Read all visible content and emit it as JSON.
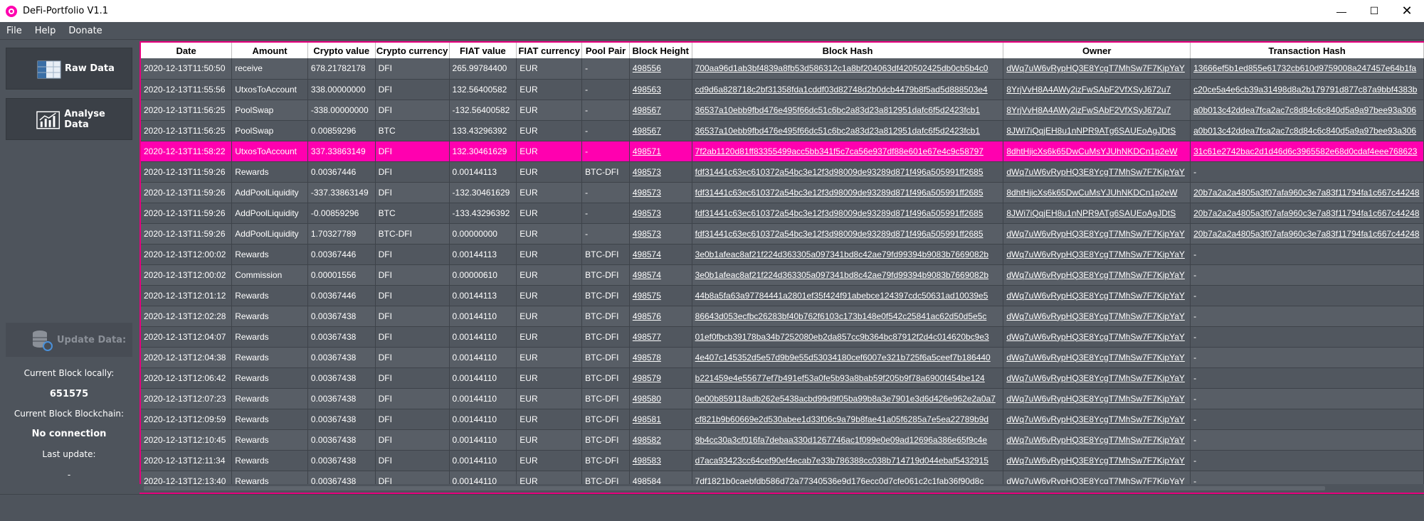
{
  "window": {
    "title": "DeFi-Portfolio V1.1"
  },
  "menu": [
    "File",
    "Help",
    "Donate"
  ],
  "sidebar": {
    "raw_data_label": "Raw Data",
    "analyse_data_label": "Analyse Data",
    "update_label": "Update Data:",
    "current_block_locally_label": "Current Block locally:",
    "current_block_locally_value": "651575",
    "current_block_blockchain_label": "Current Block Blockchain:",
    "current_block_blockchain_value": "No connection",
    "last_update_label": "Last update:",
    "last_update_value": "-"
  },
  "colors": {
    "accent": "#ff00af",
    "background": "#4e545c"
  },
  "table": {
    "columns": [
      "Date",
      "Amount",
      "Crypto value",
      "Crypto currency",
      "FIAT value",
      "FIAT currency",
      "Pool Pair",
      "Block Height",
      "Block Hash",
      "Owner",
      "Transaction Hash"
    ],
    "selected_row": 4,
    "rows": [
      [
        "2020-12-13T11:50:50",
        "receive",
        "678.21782178",
        "DFI",
        "265.99784400",
        "EUR",
        "-",
        "498556",
        "700aa96d1ab3bf4839a8fb53d586312c1a8bf204063df420502425db0cb5b4c0",
        "dWq7uW6vRypHQ3E8YcgT7MhSw7F7KipYaY",
        "13666ef5b1ed855e61732cb610d9759008a247457e64b1fa"
      ],
      [
        "2020-12-13T11:55:56",
        "UtxosToAccount",
        "338.00000000",
        "DFI",
        "132.56400582",
        "EUR",
        "-",
        "498563",
        "cd9d6a828718c2bf31358fda1cddf03d82748d2b0dcb4479b8f5ad5d888503e4",
        "8YrjVvH8A4AWy2izFwSAbF2VfXSyJ672u7",
        "c20ce5a4e6cb39a31498d8a2b179791d877c87a9bbf4383b"
      ],
      [
        "2020-12-13T11:56:25",
        "PoolSwap",
        "-338.00000000",
        "DFI",
        "-132.56400582",
        "EUR",
        "-",
        "498567",
        "36537a10ebb9fbd476e495f66dc51c6bc2a83d23a812951dafc6f5d2423fcb1",
        "8YrjVvH8A4AWy2izFwSAbF2VfXSyJ672u7",
        "a0b013c42ddea7fca2ac7c8d84c6c840d5a9a97bee93a306"
      ],
      [
        "2020-12-13T11:56:25",
        "PoolSwap",
        "0.00859296",
        "BTC",
        "133.43296392",
        "EUR",
        "-",
        "498567",
        "36537a10ebb9fbd476e495f66dc51c6bc2a83d23a812951dafc6f5d2423fcb1",
        "8JWi7iQqjEH8u1nNPR9ATg6SAUEoAgJDtS",
        "a0b013c42ddea7fca2ac7c8d84c6c840d5a9a97bee93a306"
      ],
      [
        "2020-12-13T11:58:22",
        "UtxosToAccount",
        "337.33863149",
        "DFI",
        "132.30461629",
        "EUR",
        "-",
        "498571",
        "7f2ab1120d81ff83355499acc5bb341f5c7ca56e937df88e601e67e4c9c58797",
        "8dhtHjicXs6k65DwCuMsYJUhNKDCn1p2eW",
        "31c61e2742bac2d1d46d6c3965582e68d0cdaf4eee768623"
      ],
      [
        "2020-12-13T11:59:26",
        "Rewards",
        "0.00367446",
        "DFI",
        "0.00144113",
        "EUR",
        "BTC-DFI",
        "498573",
        "fdf31441c63ec610372a54bc3e12f3d98009de93289d871f496a505991ff2685",
        "dWq7uW6vRypHQ3E8YcgT7MhSw7F7KipYaY",
        "-"
      ],
      [
        "2020-12-13T11:59:26",
        "AddPoolLiquidity",
        "-337.33863149",
        "DFI",
        "-132.30461629",
        "EUR",
        "-",
        "498573",
        "fdf31441c63ec610372a54bc3e12f3d98009de93289d871f496a505991ff2685",
        "8dhtHjicXs6k65DwCuMsYJUhNKDCn1p2eW",
        "20b7a2a2a4805a3f07afa960c3e7a83f11794fa1c667c44248"
      ],
      [
        "2020-12-13T11:59:26",
        "AddPoolLiquidity",
        "-0.00859296",
        "BTC",
        "-133.43296392",
        "EUR",
        "-",
        "498573",
        "fdf31441c63ec610372a54bc3e12f3d98009de93289d871f496a505991ff2685",
        "8JWi7iQqjEH8u1nNPR9ATg6SAUEoAgJDtS",
        "20b7a2a2a4805a3f07afa960c3e7a83f11794fa1c667c44248"
      ],
      [
        "2020-12-13T11:59:26",
        "AddPoolLiquidity",
        "1.70327789",
        "BTC-DFI",
        "0.00000000",
        "EUR",
        "-",
        "498573",
        "fdf31441c63ec610372a54bc3e12f3d98009de93289d871f496a505991ff2685",
        "dWq7uW6vRypHQ3E8YcgT7MhSw7F7KipYaY",
        "20b7a2a2a4805a3f07afa960c3e7a83f11794fa1c667c44248"
      ],
      [
        "2020-12-13T12:00:02",
        "Rewards",
        "0.00367446",
        "DFI",
        "0.00144113",
        "EUR",
        "BTC-DFI",
        "498574",
        "3e0b1afeac8af21f224d363305a097341bd8c42ae79fd99394b9083b7669082b",
        "dWq7uW6vRypHQ3E8YcgT7MhSw7F7KipYaY",
        "-"
      ],
      [
        "2020-12-13T12:00:02",
        "Commission",
        "0.00001556",
        "DFI",
        "0.00000610",
        "EUR",
        "BTC-DFI",
        "498574",
        "3e0b1afeac8af21f224d363305a097341bd8c42ae79fd99394b9083b7669082b",
        "dWq7uW6vRypHQ3E8YcgT7MhSw7F7KipYaY",
        "-"
      ],
      [
        "2020-12-13T12:01:12",
        "Rewards",
        "0.00367446",
        "DFI",
        "0.00144113",
        "EUR",
        "BTC-DFI",
        "498575",
        "44b8a5fa63a97784441a2801ef35f424f91abebce124397cdc50631ad10039e5",
        "dWq7uW6vRypHQ3E8YcgT7MhSw7F7KipYaY",
        "-"
      ],
      [
        "2020-12-13T12:02:28",
        "Rewards",
        "0.00367438",
        "DFI",
        "0.00144110",
        "EUR",
        "BTC-DFI",
        "498576",
        "86643d053ecfbc26283bf40b762f6103c173b148e0f542c25841ac62d50d5e5c",
        "dWq7uW6vRypHQ3E8YcgT7MhSw7F7KipYaY",
        "-"
      ],
      [
        "2020-12-13T12:04:07",
        "Rewards",
        "0.00367438",
        "DFI",
        "0.00144110",
        "EUR",
        "BTC-DFI",
        "498577",
        "01ef0fbcb39178ba34b7252080eb2da857cc9b364bc87912f2d4c014620bc9e3",
        "dWq7uW6vRypHQ3E8YcgT7MhSw7F7KipYaY",
        "-"
      ],
      [
        "2020-12-13T12:04:38",
        "Rewards",
        "0.00367438",
        "DFI",
        "0.00144110",
        "EUR",
        "BTC-DFI",
        "498578",
        "4e407c145352d5e57d9b9e55d53034180cef6007e321b725f6a5ceef7b186440",
        "dWq7uW6vRypHQ3E8YcgT7MhSw7F7KipYaY",
        "-"
      ],
      [
        "2020-12-13T12:06:42",
        "Rewards",
        "0.00367438",
        "DFI",
        "0.00144110",
        "EUR",
        "BTC-DFI",
        "498579",
        "b221459e4e55677ef7b491ef53a0fe5b93a8bab59f205b9f78a6900f454be124",
        "dWq7uW6vRypHQ3E8YcgT7MhSw7F7KipYaY",
        "-"
      ],
      [
        "2020-12-13T12:07:23",
        "Rewards",
        "0.00367438",
        "DFI",
        "0.00144110",
        "EUR",
        "BTC-DFI",
        "498580",
        "0e00b859118adb262e5438acbd99d9f05ba99b8a3e7901e3d6d426e962e2a0a7",
        "dWq7uW6vRypHQ3E8YcgT7MhSw7F7KipYaY",
        "-"
      ],
      [
        "2020-12-13T12:09:59",
        "Rewards",
        "0.00367438",
        "DFI",
        "0.00144110",
        "EUR",
        "BTC-DFI",
        "498581",
        "cf821b9b60669e2d530abee1d33f06c9a79b8fae41a05f6285a7e5ea22789b9d",
        "dWq7uW6vRypHQ3E8YcgT7MhSw7F7KipYaY",
        "-"
      ],
      [
        "2020-12-13T12:10:45",
        "Rewards",
        "0.00367438",
        "DFI",
        "0.00144110",
        "EUR",
        "BTC-DFI",
        "498582",
        "9b4cc30a3cf016fa7debaa330d1267746ac1f099e0e09ad12696a386e65f9c4e",
        "dWq7uW6vRypHQ3E8YcgT7MhSw7F7KipYaY",
        "-"
      ],
      [
        "2020-12-13T12:11:34",
        "Rewards",
        "0.00367438",
        "DFI",
        "0.00144110",
        "EUR",
        "BTC-DFI",
        "498583",
        "d7aca93423cc64cef90ef4ecab7e33b786388cc038b714719d044ebaf5432915",
        "dWq7uW6vRypHQ3E8YcgT7MhSw7F7KipYaY",
        "-"
      ],
      [
        "2020-12-13T12:13:40",
        "Rewards",
        "0.00367438",
        "DFI",
        "0.00144110",
        "EUR",
        "BTC-DFI",
        "498584",
        "7df1821b0caebfdb586d72a77340536e9d176ecc0d7cfe061c2c1fab36f90d8c",
        "dWq7uW6vRypHQ3E8YcgT7MhSw7F7KipYaY",
        "-"
      ]
    ]
  }
}
